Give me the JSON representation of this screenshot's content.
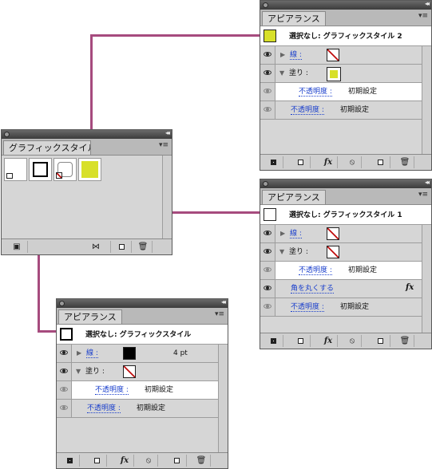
{
  "graphic_styles_panel": {
    "tab": "グラフィックスタイル"
  },
  "appearance_panel_2": {
    "tab": "アピアランス",
    "header": "選択なし: グラフィックスタイル 2",
    "stroke_label": "線 :",
    "fill_label": "塗り :",
    "fill_opacity_label": "不透明度 :",
    "fill_opacity_value": "初期設定",
    "opacity_label": "不透明度 :",
    "opacity_value": "初期設定"
  },
  "appearance_panel_1": {
    "tab": "アピアランス",
    "header": "選択なし: グラフィックスタイル 1",
    "stroke_label": "線 :",
    "fill_label": "塗り :",
    "fill_opacity_label": "不透明度 :",
    "fill_opacity_value": "初期設定",
    "effect_label": "角を丸くする",
    "opacity_label": "不透明度 :",
    "opacity_value": "初期設定"
  },
  "appearance_panel_0": {
    "tab": "アピアランス",
    "header": "選択なし: グラフィックスタイル",
    "stroke_label": "線 :",
    "stroke_weight": "4 pt",
    "fill_label": "塗り :",
    "fill_opacity_label": "不透明度 :",
    "fill_opacity_value": "初期設定",
    "opacity_label": "不透明度 :",
    "opacity_value": "初期設定"
  },
  "icons": {
    "fx": "fx",
    "menu": "▾≡",
    "collapse": "◂◂",
    "expand_arrow": "▶",
    "collapse_arrow": "▼"
  },
  "colors": {
    "connector": "#a64b7e",
    "link": "#1a3fcc",
    "swatch_yellow": "#d8e02a",
    "none_slash": "#c01010"
  }
}
